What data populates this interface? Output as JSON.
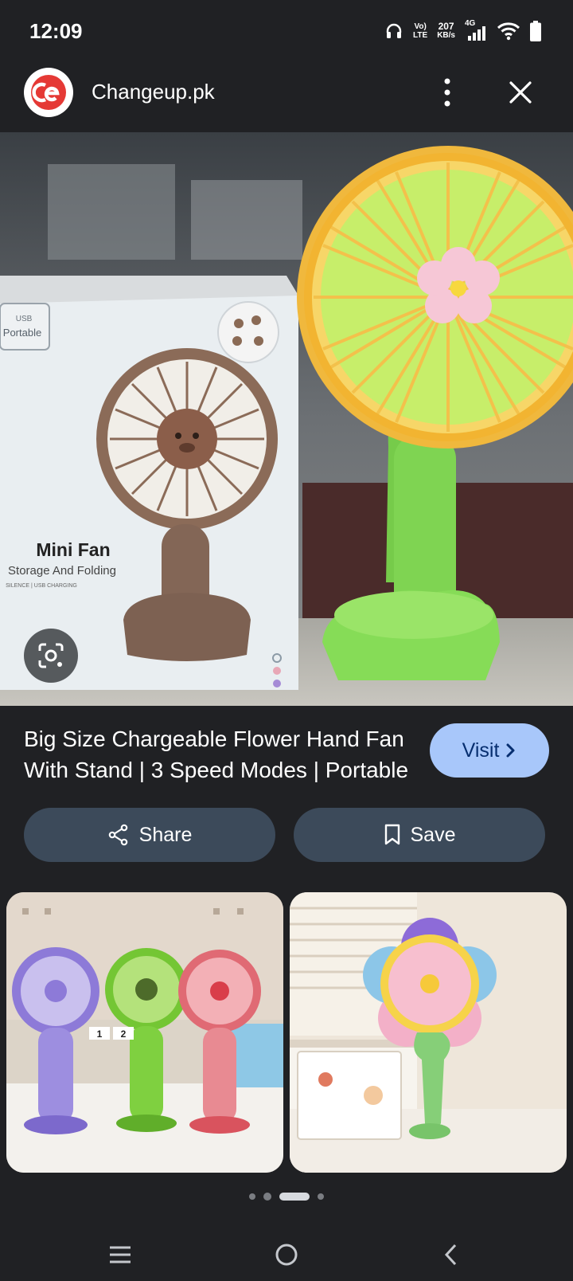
{
  "status_bar": {
    "time": "12:09",
    "volte_top": "Vo)",
    "volte_bottom": "LTE",
    "speed_value": "207",
    "speed_unit": "KB/s",
    "network": "4G",
    "icons": [
      "headphones-icon",
      "signal-icon",
      "wifi-icon",
      "battery-icon"
    ]
  },
  "header": {
    "site_name": "Changeup.pk",
    "logo_icon": "changeup-logo-icon",
    "more_icon": "more-vert-icon",
    "close_icon": "close-icon"
  },
  "hero": {
    "box_badge_top": "USB",
    "box_badge_bottom": "Portable",
    "box_title": "Mini Fan",
    "box_subtitle": "Storage And Folding",
    "box_small": "SILENCE | USB CHARGING",
    "lens_icon": "google-lens-icon"
  },
  "product": {
    "title": "Big Size Chargeable Flower Hand Fan With Stand | 3 Speed Modes | Portable",
    "visit_label": "Visit",
    "visit_icon": "chevron-right-icon"
  },
  "actions": {
    "share_label": "Share",
    "share_icon": "share-icon",
    "save_label": "Save",
    "save_icon": "bookmark-icon"
  },
  "related": {
    "count_badge_1": "1",
    "count_badge_2": "2"
  },
  "pager": {
    "active_index": 2,
    "count": 4
  },
  "nav": {
    "icons": [
      "recents-icon",
      "home-icon",
      "back-icon"
    ]
  },
  "colors": {
    "background": "#202124",
    "visit_button": "#a8c7fa",
    "action_button": "#3c4a5a",
    "logo_red": "#e53935"
  }
}
